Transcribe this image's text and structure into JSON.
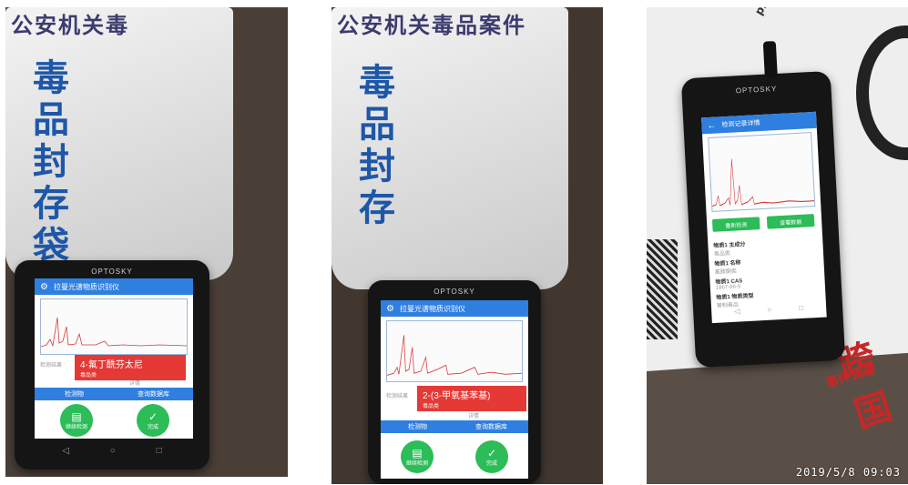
{
  "photos": [
    {
      "bag_banner": "公安机关毒",
      "bag_chars": [
        "毒",
        "品",
        "封",
        "存",
        "袋"
      ],
      "device_brand": "OPTOSKY",
      "app_title": "拉曼光谱物质识别仪",
      "result_name": "4-氟丁酰芬太尼",
      "result_sub": "毒品类",
      "side_label": "检测结果",
      "detail_link": "详情",
      "tabs": [
        "检测物",
        "查询数据库"
      ],
      "buttons": [
        {
          "label": "继续检测"
        },
        {
          "label": "完成"
        }
      ]
    },
    {
      "bag_banner": "公安机关毒品案件",
      "bag_chars": [
        "毒",
        "品",
        "封",
        "存"
      ],
      "device_brand": "OPTOSKY",
      "app_title": "拉曼光谱物质识别仪",
      "result_name": "2-(3-甲氧基苯基)",
      "result_sub": "毒品类",
      "side_label": "检测结果",
      "detail_link": "详情",
      "tabs": [
        "检测物",
        "查询数据库"
      ],
      "buttons": [
        {
          "label": "继续检测"
        },
        {
          "label": "完成"
        }
      ]
    },
    {
      "device_brand": "OPTOSKY",
      "app_title": "检测记录详情",
      "buttons": [
        {
          "label": "重新检测"
        },
        {
          "label": "查看数据"
        }
      ],
      "details": [
        {
          "label": "物质1 主成分",
          "value": "毒品类"
        },
        {
          "label": "物质1 名称",
          "value": "氯胺酮类"
        },
        {
          "label": "物质1 CAS",
          "value": "1867-66-9"
        },
        {
          "label": "物质1 物质类型",
          "value": "管制毒品"
        }
      ],
      "poster_text": "跨国",
      "poster_sub": "事件调查",
      "site_text": "press.com",
      "timestamp": "2019/5/8 09:03"
    }
  ]
}
